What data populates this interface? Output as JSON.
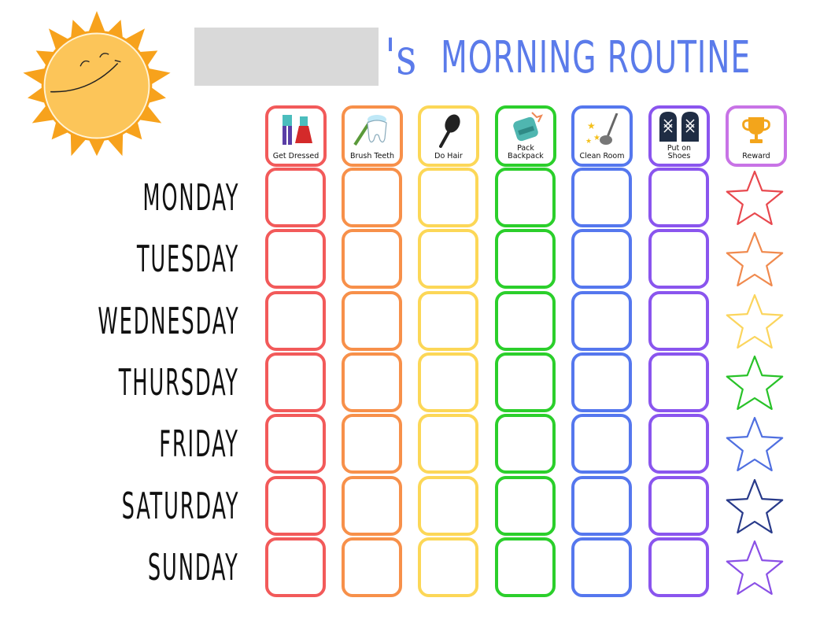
{
  "header": {
    "name_placeholder": "",
    "possessive": "'s",
    "title": "MORNING ROUTINE"
  },
  "tasks": [
    {
      "label": "Get Dressed",
      "icon": "clothes-icon",
      "color": "#f25a5a"
    },
    {
      "label": "Brush Teeth",
      "icon": "tooth-icon",
      "color": "#f7904a"
    },
    {
      "label": "Do Hair",
      "icon": "hairbrush-icon",
      "color": "#fcd757"
    },
    {
      "label": "Pack\nBackpack",
      "icon": "backpack-icon",
      "color": "#2bcf2b"
    },
    {
      "label": "Clean Room",
      "icon": "broom-icon",
      "color": "#5577ee"
    },
    {
      "label": "Put on\nShoes",
      "icon": "shoes-icon",
      "color": "#8a55ee"
    },
    {
      "label": "Reward",
      "icon": "trophy-icon",
      "color": "#c873e6"
    }
  ],
  "days": [
    {
      "label": "MONDAY",
      "star_color": "#e8484e"
    },
    {
      "label": "TUESDAY",
      "star_color": "#f08a4e"
    },
    {
      "label": "WEDNESDAY",
      "star_color": "#fbd55d"
    },
    {
      "label": "THURSDAY",
      "star_color": "#28c228"
    },
    {
      "label": "FRIDAY",
      "star_color": "#4f6fe0"
    },
    {
      "label": "SATURDAY",
      "star_color": "#283a8a"
    },
    {
      "label": "SUNDAY",
      "star_color": "#8a50e6"
    }
  ],
  "colors": {
    "title": "#5b7bea",
    "name_box": "#d9d9d9",
    "sun_outer": "#f7a21c",
    "sun_inner": "#fcc255"
  }
}
